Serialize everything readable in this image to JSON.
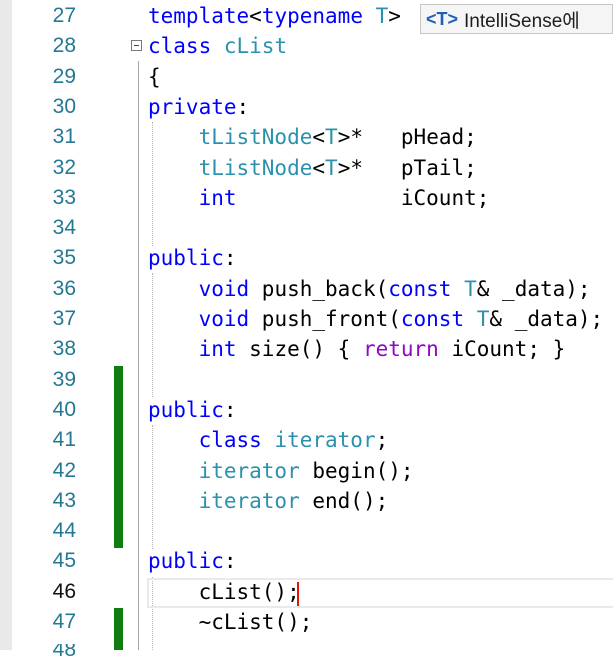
{
  "editor": {
    "line_numbers": [
      "27",
      "28",
      "29",
      "30",
      "31",
      "32",
      "33",
      "34",
      "35",
      "36",
      "37",
      "38",
      "39",
      "40",
      "41",
      "42",
      "43",
      "44",
      "45",
      "46",
      "47"
    ],
    "current_line": "46",
    "partial_next_line": "48",
    "code_lines": [
      [
        {
          "t": "template",
          "c": "k"
        },
        {
          "t": "<",
          "c": "pl"
        },
        {
          "t": "typename",
          "c": "k"
        },
        {
          "t": " ",
          "c": "pl"
        },
        {
          "t": "T",
          "c": "t"
        },
        {
          "t": ">",
          "c": "pl"
        }
      ],
      [
        {
          "t": "class",
          "c": "k"
        },
        {
          "t": " ",
          "c": "pl"
        },
        {
          "t": "cList",
          "c": "t"
        }
      ],
      [
        {
          "t": "{",
          "c": "pl"
        }
      ],
      [
        {
          "t": "private",
          "c": "k"
        },
        {
          "t": ":",
          "c": "pl"
        }
      ],
      [
        {
          "t": "    ",
          "c": "pl"
        },
        {
          "t": "tListNode",
          "c": "t"
        },
        {
          "t": "<",
          "c": "pl"
        },
        {
          "t": "T",
          "c": "t"
        },
        {
          "t": ">*   pHead;",
          "c": "pl"
        }
      ],
      [
        {
          "t": "    ",
          "c": "pl"
        },
        {
          "t": "tListNode",
          "c": "t"
        },
        {
          "t": "<",
          "c": "pl"
        },
        {
          "t": "T",
          "c": "t"
        },
        {
          "t": ">*   pTail;",
          "c": "pl"
        }
      ],
      [
        {
          "t": "    ",
          "c": "pl"
        },
        {
          "t": "int",
          "c": "k"
        },
        {
          "t": "             iCount;",
          "c": "pl"
        }
      ],
      [],
      [
        {
          "t": "public",
          "c": "k"
        },
        {
          "t": ":",
          "c": "pl"
        }
      ],
      [
        {
          "t": "    ",
          "c": "pl"
        },
        {
          "t": "void",
          "c": "k"
        },
        {
          "t": " push_back(",
          "c": "pl"
        },
        {
          "t": "const",
          "c": "k"
        },
        {
          "t": " ",
          "c": "pl"
        },
        {
          "t": "T",
          "c": "t"
        },
        {
          "t": "& _data);",
          "c": "pl"
        }
      ],
      [
        {
          "t": "    ",
          "c": "pl"
        },
        {
          "t": "void",
          "c": "k"
        },
        {
          "t": " push_front(",
          "c": "pl"
        },
        {
          "t": "const",
          "c": "k"
        },
        {
          "t": " ",
          "c": "pl"
        },
        {
          "t": "T",
          "c": "t"
        },
        {
          "t": "& _data);",
          "c": "pl"
        }
      ],
      [
        {
          "t": "    ",
          "c": "pl"
        },
        {
          "t": "int",
          "c": "k"
        },
        {
          "t": " size() { ",
          "c": "pl"
        },
        {
          "t": "return",
          "c": "pp"
        },
        {
          "t": " iCount; }",
          "c": "pl"
        }
      ],
      [],
      [
        {
          "t": "public",
          "c": "k"
        },
        {
          "t": ":",
          "c": "pl"
        }
      ],
      [
        {
          "t": "    ",
          "c": "pl"
        },
        {
          "t": "class",
          "c": "k"
        },
        {
          "t": " ",
          "c": "pl"
        },
        {
          "t": "iterator",
          "c": "t"
        },
        {
          "t": ";",
          "c": "pl"
        }
      ],
      [
        {
          "t": "    ",
          "c": "pl"
        },
        {
          "t": "iterator",
          "c": "t"
        },
        {
          "t": " begin();",
          "c": "pl"
        }
      ],
      [
        {
          "t": "    ",
          "c": "pl"
        },
        {
          "t": "iterator",
          "c": "t"
        },
        {
          "t": " end();",
          "c": "pl"
        }
      ],
      [],
      [
        {
          "t": "public",
          "c": "k"
        },
        {
          "t": ":",
          "c": "pl"
        }
      ],
      [
        {
          "t": "    cList();",
          "c": "pl"
        }
      ],
      [
        {
          "t": "    ~cList();",
          "c": "pl"
        }
      ]
    ]
  },
  "intellisense": {
    "tag": "<T>",
    "text": "IntelliSense에"
  },
  "colors": {
    "keyword": "#0000ff",
    "type": "#2b91af",
    "control_keyword": "#8f08c4",
    "line_number": "#237893",
    "change_marker": "#107c10",
    "caret": "#e51400"
  }
}
